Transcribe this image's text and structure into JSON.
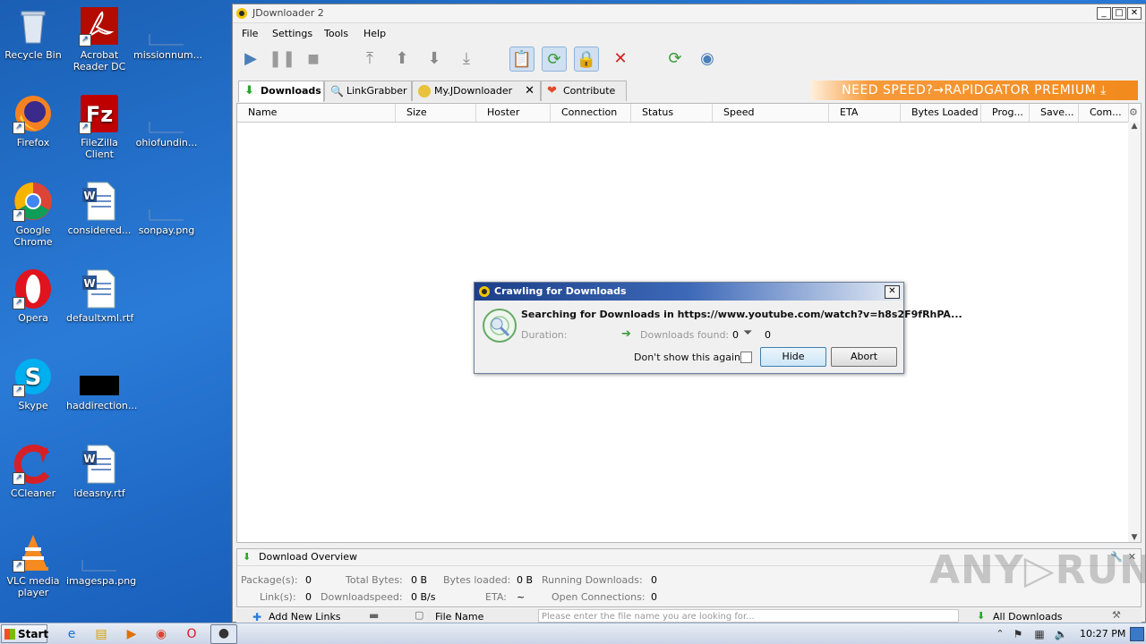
{
  "desktop": {
    "icons": [
      {
        "label": "Recycle Bin",
        "icon": "recycle-bin-icon"
      },
      {
        "label": "Acrobat\nReader DC",
        "icon": "acrobat-icon"
      },
      {
        "label": "missionnum...",
        "icon": "file-icon"
      },
      {
        "label": "Firefox",
        "icon": "firefox-icon"
      },
      {
        "label": "FileZilla Client",
        "icon": "filezilla-icon"
      },
      {
        "label": "ohiofundin...",
        "icon": "file-icon"
      },
      {
        "label": "Google\nChrome",
        "icon": "chrome-icon"
      },
      {
        "label": "considered...",
        "icon": "word-icon"
      },
      {
        "label": "sonpay.png",
        "icon": "image-file-icon"
      },
      {
        "label": "Opera",
        "icon": "opera-icon"
      },
      {
        "label": "defaultxml.rtf",
        "icon": "word-icon"
      },
      {
        "label": "Skype",
        "icon": "skype-icon"
      },
      {
        "label": "haddirection...",
        "icon": "black-file-icon"
      },
      {
        "label": "CCleaner",
        "icon": "ccleaner-icon"
      },
      {
        "label": "ideasny.rtf",
        "icon": "word-icon"
      },
      {
        "label": "VLC media\nplayer",
        "icon": "vlc-icon"
      },
      {
        "label": "imagespa.png",
        "icon": "image-file-icon"
      }
    ]
  },
  "window": {
    "title": "JDownloader 2",
    "menu": [
      "File",
      "Settings",
      "Tools",
      "Help"
    ],
    "tabs": [
      {
        "label": "Downloads",
        "icon": "download-arrow-icon"
      },
      {
        "label": "LinkGrabber",
        "icon": "linkgrabber-icon"
      },
      {
        "label": "My.JDownloader",
        "icon": "myjd-icon"
      },
      {
        "label": "Contribute",
        "icon": "heart-icon"
      }
    ],
    "banner": "NEED SPEED?→RAPIDGATOR PREMIUM",
    "columns": [
      "Name",
      "Size",
      "Hoster",
      "Connection",
      "Status",
      "Speed",
      "ETA",
      "Bytes Loaded",
      "Prog...",
      "Save...",
      "Com..."
    ],
    "overview": {
      "title": "Download Overview",
      "packages_label": "Package(s):",
      "packages": "0",
      "total_bytes_label": "Total Bytes:",
      "total_bytes": "0 B",
      "bytes_loaded_label": "Bytes loaded:",
      "bytes_loaded": "0 B",
      "running_label": "Running Downloads:",
      "running": "0",
      "links_label": "Link(s):",
      "links": "0",
      "speed_label": "Downloadspeed:",
      "speed": "0 B/s",
      "eta_label": "ETA:",
      "eta": "~",
      "open_conn_label": "Open Connections:",
      "open_conn": "0"
    },
    "bottombar": {
      "add_links": "Add New Links",
      "file_name": "File Name",
      "search_placeholder": "Please enter the file name you are looking for...",
      "all_downloads": "All Downloads"
    }
  },
  "dialog": {
    "title": "Crawling for Downloads",
    "message": "Searching for Downloads in https://www.youtube.com/watch?v=h8s2F9fRhPA...",
    "duration_label": "Duration:",
    "found_label": "Downloads found:",
    "found_value": "0",
    "filtered_value": "0",
    "dont_show": "Don't show this again",
    "hide": "Hide",
    "abort": "Abort"
  },
  "taskbar": {
    "start": "Start",
    "time": "10:27 PM"
  },
  "watermark": "ANY▷RUN"
}
